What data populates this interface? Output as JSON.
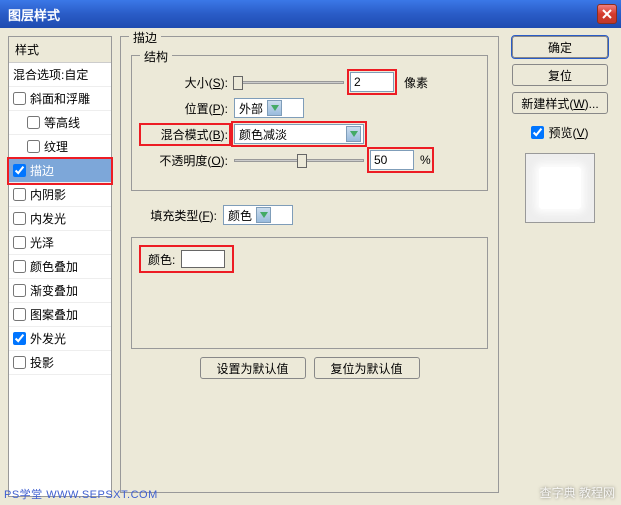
{
  "title": "图层样式",
  "left_header": "样式",
  "left_sub": "混合选项:自定",
  "styles": [
    {
      "label": "斜面和浮雕",
      "checked": false,
      "selected": false
    },
    {
      "label": "等高线",
      "checked": false,
      "selected": false,
      "indent": true
    },
    {
      "label": "纹理",
      "checked": false,
      "selected": false,
      "indent": true
    },
    {
      "label": "描边",
      "checked": true,
      "selected": true,
      "highlight": true
    },
    {
      "label": "内阴影",
      "checked": false,
      "selected": false
    },
    {
      "label": "内发光",
      "checked": false,
      "selected": false
    },
    {
      "label": "光泽",
      "checked": false,
      "selected": false
    },
    {
      "label": "颜色叠加",
      "checked": false,
      "selected": false
    },
    {
      "label": "渐变叠加",
      "checked": false,
      "selected": false
    },
    {
      "label": "图案叠加",
      "checked": false,
      "selected": false
    },
    {
      "label": "外发光",
      "checked": true,
      "selected": false
    },
    {
      "label": "投影",
      "checked": false,
      "selected": false
    }
  ],
  "panel_title": "描边",
  "struct_title": "结构",
  "size_label": "大小(S):",
  "size_value": "2",
  "size_unit": "像素",
  "position_label": "位置(P):",
  "position_value": "外部",
  "blend_label": "混合模式(B):",
  "blend_value": "颜色减淡",
  "opacity_label": "不透明度(O):",
  "opacity_value": "50",
  "opacity_unit": "%",
  "fill_type_label": "填充类型(F):",
  "fill_type_value": "颜色",
  "color_label": "颜色:",
  "set_default": "设置为默认值",
  "reset_default": "复位为默认值",
  "ok": "确定",
  "cancel": "复位",
  "new_style": "新建样式(W)...",
  "preview_label": "预览(V)",
  "wm_left": "PS学堂 WWW.SEPSXT.COM",
  "wm_right": "查字典 教程网"
}
